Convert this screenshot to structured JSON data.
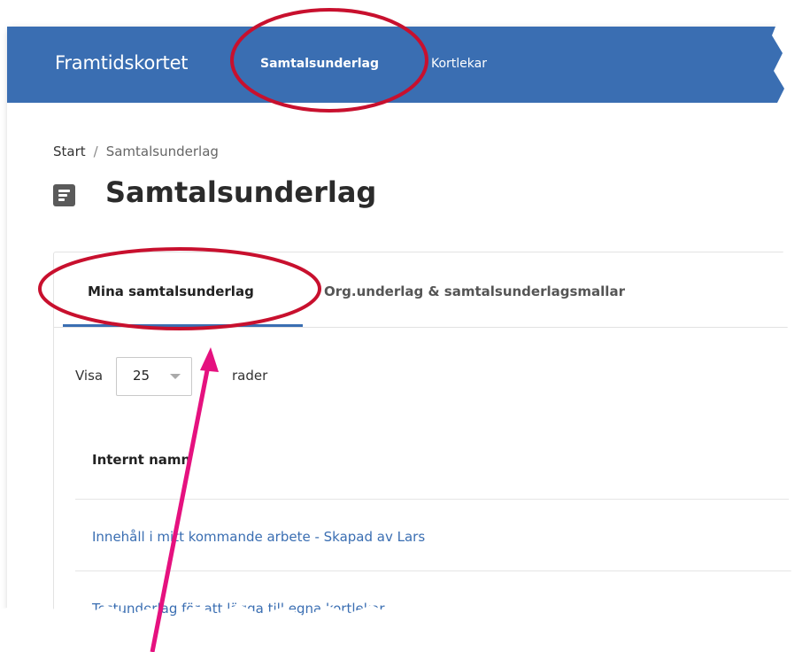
{
  "navbar": {
    "brand": "Framtidskortet",
    "links": [
      {
        "label": "Samtalsunderlag",
        "active": true
      },
      {
        "label": "Kortlekar",
        "active": false
      }
    ]
  },
  "breadcrumb": {
    "home": "Start",
    "separator": "/",
    "current": "Samtalsunderlag"
  },
  "page": {
    "title": "Samtalsunderlag",
    "icon": "document-icon"
  },
  "tabs": [
    {
      "label": "Mina samtalsunderlag",
      "active": true
    },
    {
      "label": "Org.underlag & samtalsunderlagsmallar",
      "active": false
    }
  ],
  "table_length": {
    "prefix": "Visa",
    "value": "25",
    "suffix": "rader"
  },
  "table": {
    "columns": [
      "Internt namn"
    ],
    "rows": [
      "Innehåll i mitt kommande arbete - Skapad av Lars",
      "Testunderlag för att lägga till egna kortlekar"
    ]
  },
  "annotations": {
    "circle_color": "#c8102e",
    "arrow_color": "#e5117f"
  },
  "colors": {
    "navbar": "#3a6eb2",
    "link": "#3a6eb2"
  }
}
